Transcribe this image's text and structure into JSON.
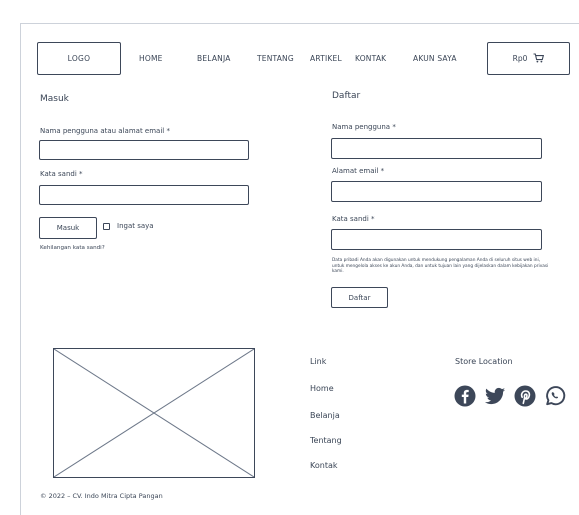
{
  "header": {
    "logo": "LOGO",
    "nav": [
      {
        "label": "HOME"
      },
      {
        "label": "BELANJA"
      },
      {
        "label": "TENTANG"
      },
      {
        "label": "ARTIKEL"
      },
      {
        "label": "KONTAK"
      },
      {
        "label": "AKUN SAYA"
      }
    ],
    "cart_total": "Rp0"
  },
  "login": {
    "title": "Masuk",
    "username_label": "Nama pengguna atau alamat email *",
    "username_value": "",
    "password_label": "Kata sandi *",
    "password_value": "",
    "submit_label": "Masuk",
    "remember_label": "Ingat saya",
    "remember_checked": false,
    "lost_password": "Kehilangan kata sandi?"
  },
  "register": {
    "title": "Daftar",
    "username_label": "Nama pengguna *",
    "username_value": "",
    "email_label": "Alamat email *",
    "email_value": "",
    "password_label": "Kata sandi *",
    "password_value": "",
    "privacy_text": "Data pribadi Anda akan digunakan untuk mendukung pengalaman Anda di seluruh situs web ini, untuk mengelola akses ke akun Anda, dan untuk tujuan lain yang dijelaskan dalam kebijakan privasi kami.",
    "submit_label": "Daftar"
  },
  "footer": {
    "links_title": "Link",
    "links": [
      {
        "label": "Home"
      },
      {
        "label": "Belanja"
      },
      {
        "label": "Tentang"
      },
      {
        "label": "Kontak"
      }
    ],
    "store_title": "Store Location",
    "social_icons": [
      "facebook-icon",
      "twitter-icon",
      "pinterest-icon",
      "whatsapp-icon"
    ],
    "copyright": "© 2022 – CV. Indo Mitra Cipta Pangan"
  },
  "colors": {
    "line": "#3d4759",
    "text": "#3a4556",
    "frame": "#cdd2da"
  }
}
